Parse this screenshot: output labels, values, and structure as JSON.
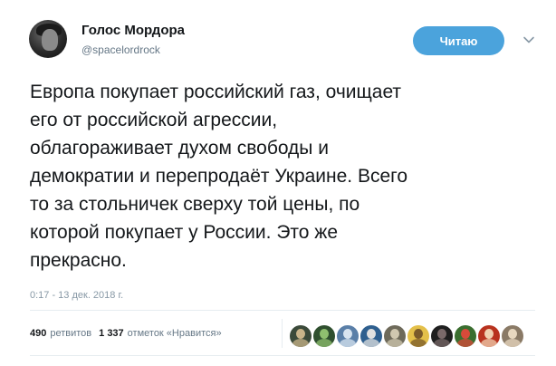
{
  "tweet": {
    "author_name": "Голос Мордора",
    "author_handle": "@spacelordrock",
    "follow_label": "Читаю",
    "text": "Европа покупает российский газ, очищает\nего от российской агрессии,\nоблагораживает духом свободы и\nдемократии и перепродаёт Украине. Всего\nто за стольничек сверху той цены, по\nкоторой покупает у России. Это же\nпрекрасно.",
    "timestamp": "0:17 - 13 дек. 2018 г.",
    "retweets_count": "490",
    "retweets_label": "ретвитов",
    "likes_count": "1 337",
    "likes_label": "отметок «Нравится»"
  },
  "colors": {
    "accent": "#4ba3dc",
    "text": "#14171a",
    "muted": "#657786",
    "divider": "#e6ecf0"
  },
  "icons": {
    "caret": "chevron-down-icon"
  },
  "likers": [
    {
      "bg": "#3b4a3a",
      "fg": "#c9b48a"
    },
    {
      "bg": "#2f4f2f",
      "fg": "#8fbf6f"
    },
    {
      "bg": "#5a7fa8",
      "fg": "#d8e4f0"
    },
    {
      "bg": "#2e5f8f",
      "fg": "#e0e0e0"
    },
    {
      "bg": "#6e6a5a",
      "fg": "#d0c8b0"
    },
    {
      "bg": "#e4c04a",
      "fg": "#7a5a2a"
    },
    {
      "bg": "#1f1f1f",
      "fg": "#7a6a6a"
    },
    {
      "bg": "#3a6e2f",
      "fg": "#d84a3a"
    },
    {
      "bg": "#b8321e",
      "fg": "#f0d0b0"
    },
    {
      "bg": "#8a7a66",
      "fg": "#e8d8c0"
    }
  ]
}
